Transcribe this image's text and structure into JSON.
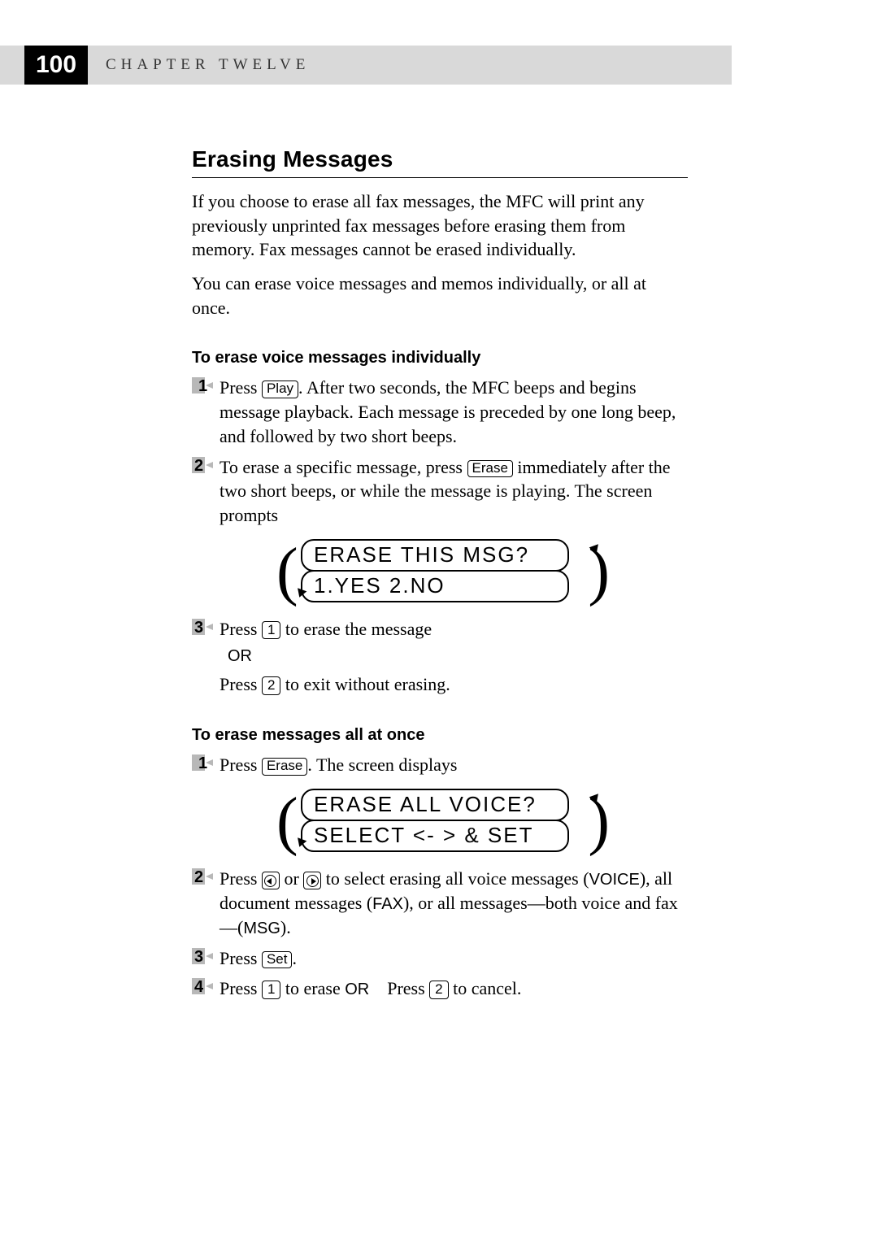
{
  "header": {
    "page_number": "100",
    "chapter_label": "CHAPTER TWELVE"
  },
  "section": {
    "heading": "Erasing Messages",
    "intro1": "If you choose to erase all fax messages, the MFC will print any previously unprinted fax messages before erasing them from memory. Fax messages cannot be erased individually.",
    "intro2": "You can erase voice messages and memos individually, or all at once."
  },
  "sub1": {
    "heading": "To erase voice messages individually",
    "step1_a": "Press ",
    "step1_b": ". After two seconds, the MFC beeps and begins message playback. Each message is preceded by one long beep, and followed by two short beeps.",
    "step2_a": "To erase a specific message, press ",
    "step2_b": " immediately after the two short beeps, or while the message is playing. The screen prompts",
    "lcd_line1": "ERASE THIS MSG?",
    "lcd_line2": "1.YES 2.NO",
    "step3_a": "Press ",
    "step3_b": " to erase the message",
    "or": "OR",
    "step3_c": "Press ",
    "step3_d": " to exit without erasing."
  },
  "sub2": {
    "heading": "To erase messages all at once",
    "step1_a": "Press ",
    "step1_b": ". The screen displays",
    "lcd_line1": "ERASE ALL VOICE?",
    "lcd_line2": "SELECT <- > & SET",
    "step2_a": "Press ",
    "step2_b": " or ",
    "step2_c": " to select erasing all voice messages (",
    "step2_d": "), all document messages (",
    "step2_e": "), or all messages—both voice and fax—(",
    "step2_f": ").",
    "voice_label": "VOICE",
    "fax_label": "FAX",
    "msg_label": "MSG",
    "step3_a": "Press ",
    "step3_b": ".",
    "step4_a": "Press ",
    "step4_b": " to erase ",
    "step4_or": "OR",
    "step4_c": "Press ",
    "step4_d": " to cancel."
  },
  "keys": {
    "play": "Play",
    "erase": "Erase",
    "one": "1",
    "two": "2",
    "set": "Set"
  }
}
